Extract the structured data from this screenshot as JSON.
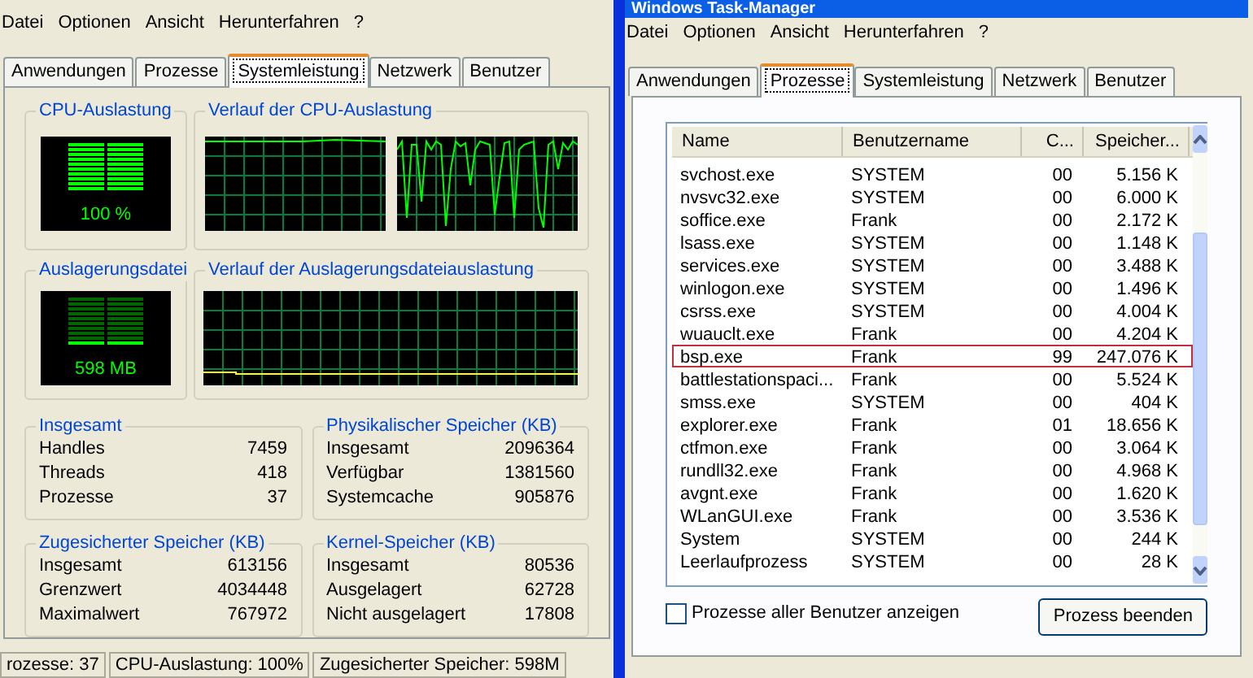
{
  "left_window": {
    "menu": [
      "Datei",
      "Optionen",
      "Ansicht",
      "Herunterfahren",
      "?"
    ],
    "tabs": [
      {
        "label": "Anwendungen",
        "selected": false
      },
      {
        "label": "Prozesse",
        "selected": false
      },
      {
        "label": "Systemleistung",
        "selected": true
      },
      {
        "label": "Netzwerk",
        "selected": false
      },
      {
        "label": "Benutzer",
        "selected": false
      }
    ],
    "cpu_usage": {
      "title": "CPU-Auslastung",
      "reading": "100 %",
      "level": 1
    },
    "cpu_history": {
      "title": "Verlauf der CPU-Auslastung"
    },
    "pagefile": {
      "title": "Auslagerungsdatei",
      "reading": "598 MB",
      "level": 0.1
    },
    "pagefile_history": {
      "title": "Verlauf der Auslagerungsdateiauslastung"
    },
    "stat_groups": [
      {
        "title": "Insgesamt",
        "rows": [
          {
            "label": "Handles",
            "value": "7459"
          },
          {
            "label": "Threads",
            "value": "418"
          },
          {
            "label": "Prozesse",
            "value": "37"
          }
        ]
      },
      {
        "title": "Physikalischer Speicher (KB)",
        "rows": [
          {
            "label": "Insgesamt",
            "value": "2096364"
          },
          {
            "label": "Verfügbar",
            "value": "1381560"
          },
          {
            "label": "Systemcache",
            "value": "905876"
          }
        ]
      },
      {
        "title": "Zugesicherter Speicher (KB)",
        "rows": [
          {
            "label": "Insgesamt",
            "value": "613156"
          },
          {
            "label": "Grenzwert",
            "value": "4034448"
          },
          {
            "label": "Maximalwert",
            "value": "767972"
          }
        ]
      },
      {
        "title": "Kernel-Speicher (KB)",
        "rows": [
          {
            "label": "Insgesamt",
            "value": "80536"
          },
          {
            "label": "Ausgelagert",
            "value": "62728"
          },
          {
            "label": "Nicht ausgelagert",
            "value": "17808"
          }
        ]
      }
    ],
    "status_bar": [
      "rozesse: 37",
      "CPU-Auslastung: 100%",
      "Zugesicherter Speicher: 598M"
    ]
  },
  "right_window": {
    "title": "Windows Task-Manager",
    "menu": [
      "Datei",
      "Optionen",
      "Ansicht",
      "Herunterfahren",
      "?"
    ],
    "tabs": [
      {
        "label": "Anwendungen",
        "selected": false
      },
      {
        "label": "Prozesse",
        "selected": true
      },
      {
        "label": "Systemleistung",
        "selected": false
      },
      {
        "label": "Netzwerk",
        "selected": false
      },
      {
        "label": "Benutzer",
        "selected": false
      }
    ],
    "table": {
      "columns": [
        "Name",
        "Benutzername",
        "C...",
        "Speicher..."
      ],
      "rows": [
        {
          "cells": [
            "svchost.exe",
            "SYSTEM",
            "00",
            "5.156 K"
          ],
          "selected": false
        },
        {
          "cells": [
            "nvsvc32.exe",
            "SYSTEM",
            "00",
            "6.000 K"
          ],
          "selected": false
        },
        {
          "cells": [
            "soffice.exe",
            "Frank",
            "00",
            "2.172 K"
          ],
          "selected": false
        },
        {
          "cells": [
            "lsass.exe",
            "SYSTEM",
            "00",
            "1.148 K"
          ],
          "selected": false
        },
        {
          "cells": [
            "services.exe",
            "SYSTEM",
            "00",
            "3.488 K"
          ],
          "selected": false
        },
        {
          "cells": [
            "winlogon.exe",
            "SYSTEM",
            "00",
            "1.496 K"
          ],
          "selected": false
        },
        {
          "cells": [
            "csrss.exe",
            "SYSTEM",
            "00",
            "4.004 K"
          ],
          "selected": false
        },
        {
          "cells": [
            "wuauclt.exe",
            "Frank",
            "00",
            "4.204 K"
          ],
          "selected": false
        },
        {
          "cells": [
            "bsp.exe",
            "Frank",
            "99",
            "247.076 K"
          ],
          "selected": true
        },
        {
          "cells": [
            "battlestationspaci...",
            "Frank",
            "00",
            "5.524 K"
          ],
          "selected": false
        },
        {
          "cells": [
            "smss.exe",
            "SYSTEM",
            "00",
            "404 K"
          ],
          "selected": false
        },
        {
          "cells": [
            "explorer.exe",
            "Frank",
            "01",
            "18.656 K"
          ],
          "selected": false
        },
        {
          "cells": [
            "ctfmon.exe",
            "Frank",
            "00",
            "3.064 K"
          ],
          "selected": false
        },
        {
          "cells": [
            "rundll32.exe",
            "Frank",
            "00",
            "4.968 K"
          ],
          "selected": false
        },
        {
          "cells": [
            "avgnt.exe",
            "Frank",
            "00",
            "1.620 K"
          ],
          "selected": false
        },
        {
          "cells": [
            "WLanGUI.exe",
            "Frank",
            "00",
            "3.536 K"
          ],
          "selected": false
        },
        {
          "cells": [
            "System",
            "SYSTEM",
            "00",
            "244 K"
          ],
          "selected": false
        },
        {
          "cells": [
            "Leerlaufprozess",
            "SYSTEM",
            "00",
            "28 K"
          ],
          "selected": false
        }
      ]
    },
    "show_all_users": {
      "label": "Prozesse aller Benutzer anzeigen",
      "checked": false
    },
    "end_button": "Prozess beenden"
  }
}
